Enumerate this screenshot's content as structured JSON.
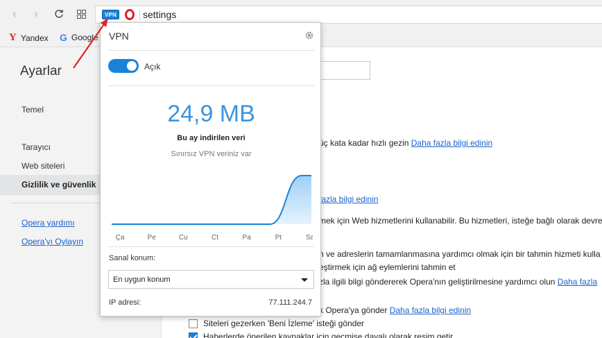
{
  "browser": {
    "address_text": "settings",
    "vpn_badge": "VPN",
    "bookmarks": [
      {
        "label": "Yandex",
        "icon": "yandex-icon"
      },
      {
        "label": "Google",
        "icon": "google-icon"
      }
    ],
    "icons": {
      "back": "arrow-left-icon",
      "forward": "arrow-right-icon",
      "reload": "reload-icon",
      "speed_dial": "grid-icon"
    }
  },
  "sidebar": {
    "title": "Ayarlar",
    "items": [
      {
        "label": "Temel"
      },
      {
        "label": "Tarayıcı"
      },
      {
        "label": "Web siteleri"
      },
      {
        "label": "Gizlilik ve güvenlik"
      }
    ],
    "links": [
      {
        "label": "Opera yardımı"
      },
      {
        "label": "Opera'yı Oylayın"
      }
    ]
  },
  "main": {
    "lines": [
      {
        "text": "üç kata kadar hızlı gezin ",
        "link": "Daha fazla bilgi edinin"
      },
      {
        "text": "",
        "link": "fazla bilgi edinin"
      },
      {
        "text": "mek için Web hizmetlerini kullanabilir. Bu hizmetleri, isteğe bağlı olarak devre",
        "link": ""
      },
      {
        "text": "n ve adreslerin tamamlanmasına yardımcı olmak için bir tahmin hizmeti kulla",
        "link": ""
      },
      {
        "text": "eştirmek için ağ eylemlerini tahmin et",
        "link": ""
      },
      {
        "text": "zla ilgili bilgi göndererek Opera'nın geliştirilmesine yardımcı olun ",
        "link": "Daha fazla"
      },
      {
        "text": "k Opera'ya gönder ",
        "link": "Daha fazla bilgi edinin"
      }
    ],
    "checkboxes": [
      {
        "label": "Siteleri gezerken 'Beni İzleme' isteği gönder",
        "checked": false
      },
      {
        "label": "Haberlerde önerilen kaynaklar için geçmişe dayalı olarak resim getir",
        "checked": true
      }
    ]
  },
  "vpn_popup": {
    "title": "VPN",
    "toggle_label": "Açık",
    "toggle_on": true,
    "data_amount": "24,9 MB",
    "data_caption": "Bu ay indirilen veri",
    "data_note": "Sınırsız VPN veriniz var",
    "location_label": "Sanal konum:",
    "location_value": "En uygun konum",
    "ip_label": "IP adresi:",
    "ip_value": "77.111.244.7",
    "accent_color": "#1a82d8"
  },
  "chart_data": {
    "type": "area",
    "categories": [
      "Ça",
      "Pe",
      "Cu",
      "Ct",
      "Pa",
      "Pt",
      "Sa"
    ],
    "values": [
      0,
      0,
      0,
      0,
      0,
      0,
      24.9
    ],
    "title": "",
    "xlabel": "",
    "ylabel": "",
    "grid": false
  }
}
